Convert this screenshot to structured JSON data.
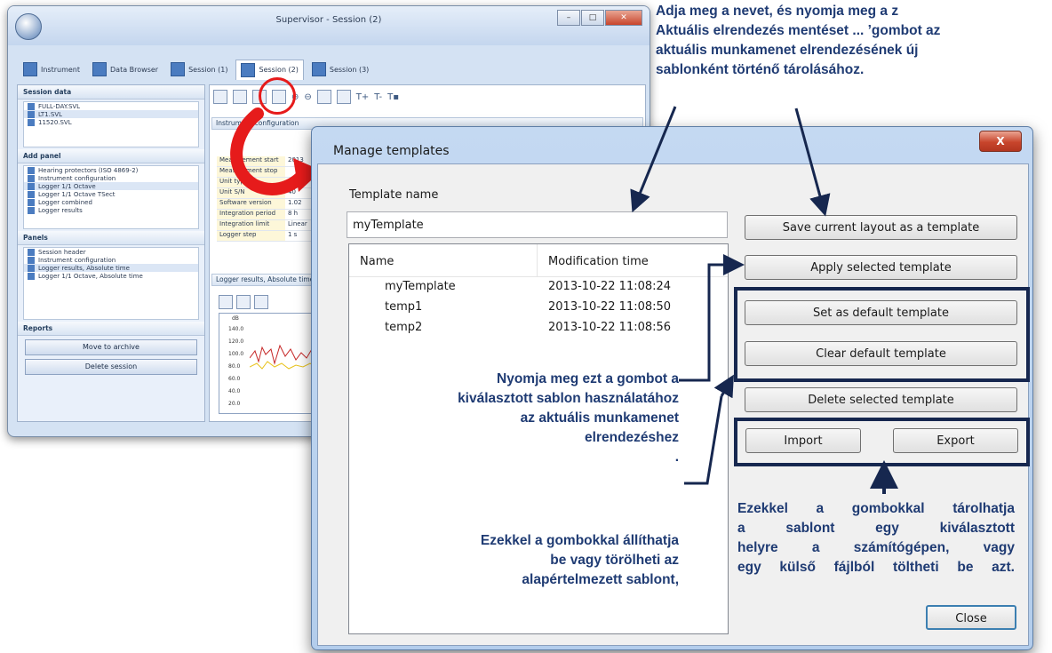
{
  "background_window": {
    "title": "Supervisor - Session (2)",
    "tabs": [
      "Instrument",
      "Data Browser",
      "Session (1)",
      "Session (2)",
      "Session (3)"
    ],
    "session_data_header": "Session data",
    "session_files": [
      "FULL-DAY.SVL",
      "LT1.SVL",
      "11520.SVL"
    ],
    "add_panel_header": "Add panel",
    "add_panel_items": [
      "Hearing protectors (ISO 4869-2)",
      "Instrument configuration",
      "Logger 1/1 Octave",
      "Logger 1/1 Octave TSect",
      "Logger combined",
      "Logger results"
    ],
    "panels_header": "Panels",
    "panels_items": [
      "Session header",
      "Instrument configuration",
      "Logger results, Absolute time",
      "Logger 1/1 Octave, Absolute time"
    ],
    "reports_header": "Reports",
    "move_to_archive": "Move to archive",
    "delete_session": "Delete session",
    "instrument_config_header": "Instrument configuration",
    "config_rows": [
      {
        "k": "Measurement start",
        "v": "2013"
      },
      {
        "k": "Measurement stop",
        "v": ""
      },
      {
        "k": "Unit type",
        "v": ""
      },
      {
        "k": "Unit S/N",
        "v": "40"
      },
      {
        "k": "Software version",
        "v": "1.02"
      },
      {
        "k": "Integration period",
        "v": "8 h"
      },
      {
        "k": "Integration limit",
        "v": "Linear"
      },
      {
        "k": "Logger step",
        "v": "1 s"
      }
    ],
    "logger_results_header": "Logger results, Absolute time",
    "chart_unit": "dB",
    "chart_ticks": [
      "140.0",
      "120.0",
      "100.0",
      "80.0",
      "60.0",
      "40.0",
      "20.0"
    ]
  },
  "dialog": {
    "title": "Manage templates",
    "close_x": "X",
    "template_name_label": "Template name",
    "template_name_value": "myTemplate",
    "columns": [
      "Name",
      "Modification time"
    ],
    "rows": [
      {
        "name": "myTemplate",
        "time": "2013-10-22 11:08:24"
      },
      {
        "name": "temp1",
        "time": "2013-10-22 11:08:50"
      },
      {
        "name": "temp2",
        "time": "2013-10-22 11:08:56"
      }
    ],
    "buttons": {
      "save": "Save current layout as a template",
      "apply": "Apply selected template",
      "set_default": "Set as default template",
      "clear_default": "Clear default template",
      "delete": "Delete selected template",
      "import": "Import",
      "export": "Export",
      "close": "Close"
    }
  },
  "annotations": {
    "top_right": [
      "Adja meg a nevet, és nyomja meg a z",
      "Aktuális elrendezés mentéset ... ’gombot az",
      "aktuális munkamenet elrendezésének új",
      "sablonként történő tárolásához."
    ],
    "apply_note": [
      "Nyomja meg ezt a gombot a",
      "kiválasztott sablon  használatához",
      "az aktuális munkamenet",
      "elrendezéshez",
      "."
    ],
    "default_note": [
      "Ezekkel a gombokkal állíthatja",
      "be vagy törölheti az",
      "alapértelmezett sablont,"
    ],
    "import_note": [
      "Ezekkel a gombokkal tárolhatja",
      "a   sablont   egy   kiválasztott",
      "helyre  a  számítógépen,  vagy",
      "egy külső fájlból töltheti be azt."
    ]
  },
  "colors": {
    "annotation_text": "#1f3b73",
    "annotation_arrow": "#16274f",
    "highlight_red": "#e61b1b"
  }
}
